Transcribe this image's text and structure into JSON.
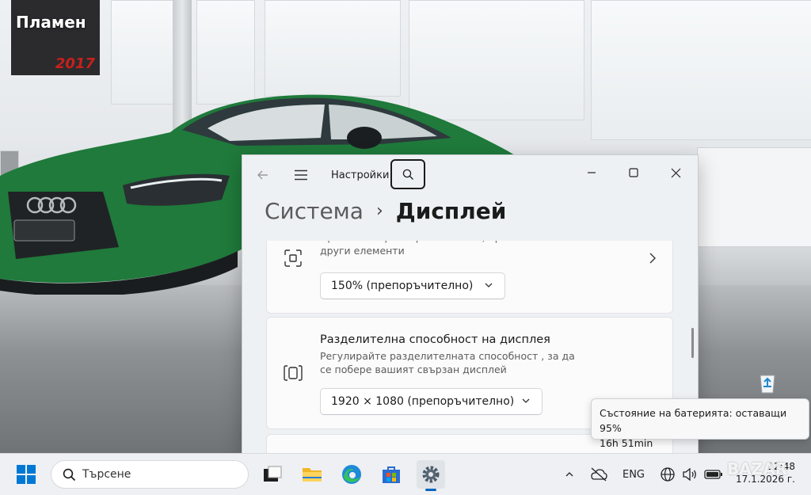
{
  "desktop": {
    "username": "Пламен",
    "poster_year": "2017"
  },
  "settings": {
    "app_title": "Настройки",
    "breadcrumb_parent": "Система",
    "breadcrumb_separator": "›",
    "breadcrumb_current": "Дисплей",
    "scale_card": {
      "desc": "Промяна на размера на текста, приложенията и други елементи",
      "value": "150% (препоръчително)"
    },
    "resolution_card": {
      "title": "Разделителна способност на дисплея",
      "desc": "Регулирайте разделителната способност , за да се побере вашият свързан дисплей",
      "value": "1920 × 1080 (препоръчително)"
    }
  },
  "tooltip": {
    "line1": "Състояние на батерията: оставащи 95%",
    "line2": "16h 51min"
  },
  "taskbar": {
    "search_placeholder": "Търсене",
    "language": "ENG",
    "time": "12:48",
    "date": "17.1.2026 г.",
    "accent": "#0067c0"
  },
  "watermark": "BAZAR"
}
